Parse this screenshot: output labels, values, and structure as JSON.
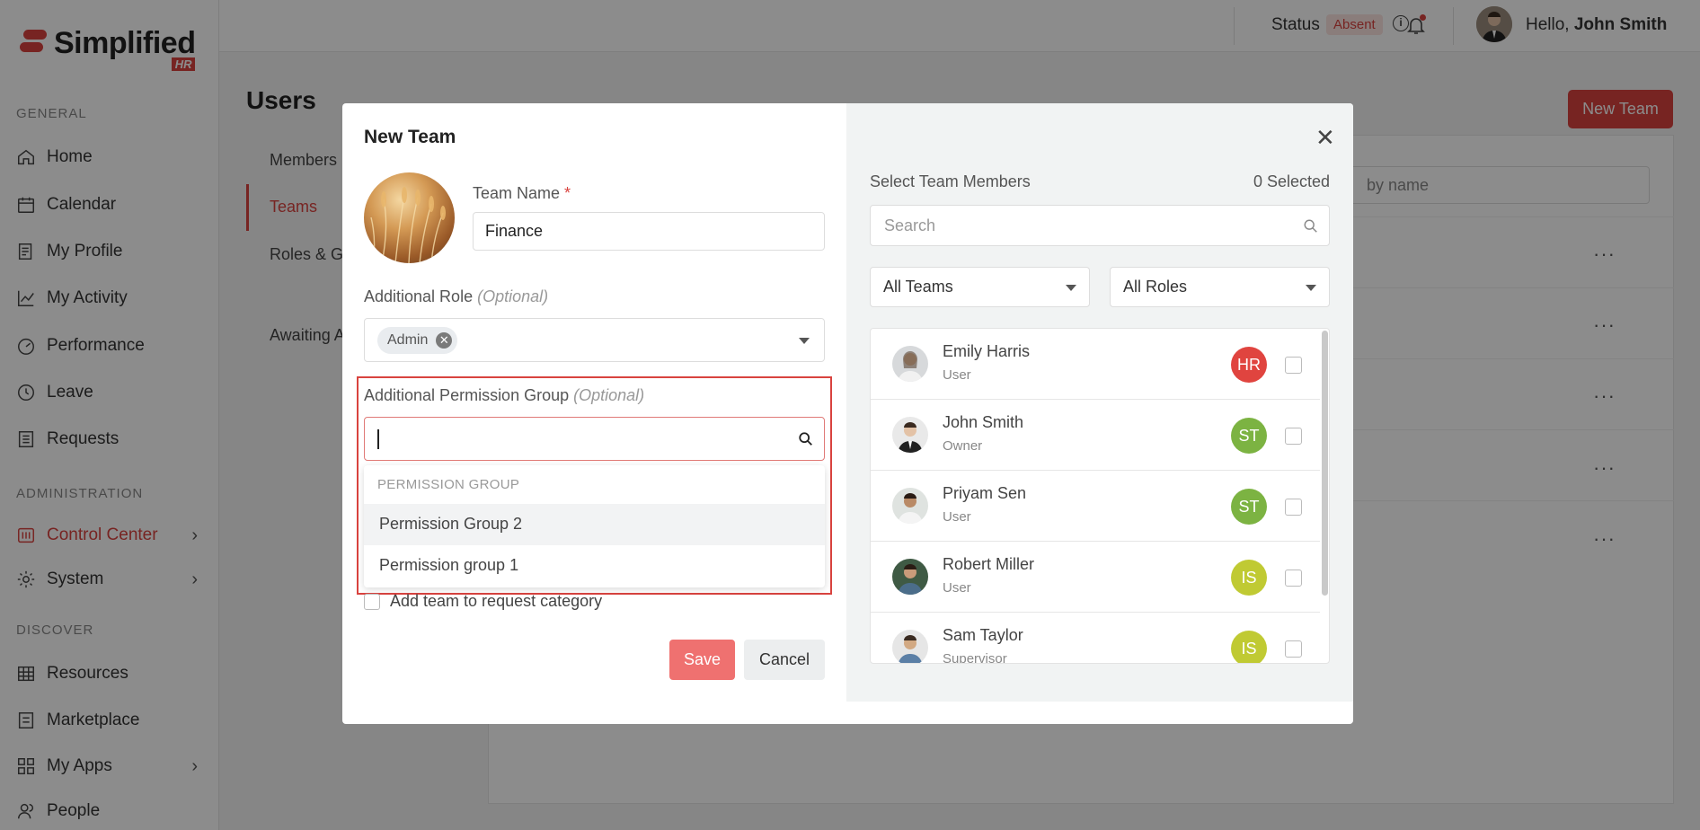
{
  "brand": {
    "name": "Simplified",
    "tag": "HR",
    "accent": "#d9433f"
  },
  "sidebar": {
    "sections": [
      "GENERAL",
      "ADMINISTRATION",
      "DISCOVER"
    ],
    "items": [
      {
        "label": "Home",
        "icon": "home-icon"
      },
      {
        "label": "Calendar",
        "icon": "calendar-icon"
      },
      {
        "label": "My Profile",
        "icon": "profile-icon"
      },
      {
        "label": "My Activity",
        "icon": "activity-icon"
      },
      {
        "label": "Performance",
        "icon": "performance-icon"
      },
      {
        "label": "Leave",
        "icon": "clock-icon"
      },
      {
        "label": "Requests",
        "icon": "requests-icon"
      },
      {
        "label": "Control Center",
        "icon": "control-center-icon",
        "active": true
      },
      {
        "label": "System",
        "icon": "gear-icon"
      },
      {
        "label": "Resources",
        "icon": "resources-icon"
      },
      {
        "label": "Marketplace",
        "icon": "marketplace-icon"
      },
      {
        "label": "My Apps",
        "icon": "apps-icon"
      },
      {
        "label": "People",
        "icon": "people-icon"
      }
    ]
  },
  "topbar": {
    "status_label": "Status",
    "status_value": "Absent",
    "hello": "Hello,",
    "user_name": "John Smith"
  },
  "page": {
    "title": "Users",
    "new_team_button": "New Team",
    "subnav": [
      "Members",
      "Teams",
      "Roles & Gr",
      "Awaiting A"
    ],
    "search_placeholder": "by name"
  },
  "modal": {
    "title": "New Team",
    "team_name_label": "Team Name",
    "required_mark": "*",
    "team_name_value": "Finance",
    "role_label": "Additional Role",
    "optional_text": "(Optional)",
    "role_chip": "Admin",
    "perm_label": "Additional Permission Group",
    "perm_input_value": "",
    "dropdown": {
      "group_header": "PERMISSION GROUP",
      "options": [
        "Permission Group 2",
        "Permission group 1"
      ]
    },
    "request_category_label": "Add team to request category",
    "save_button": "Save",
    "cancel_button": "Cancel",
    "select_members_title": "Select Team Members",
    "selected_count": "0 Selected",
    "member_search_placeholder": "Search",
    "filter_teams": "All Teams",
    "filter_roles": "All Roles",
    "members": [
      {
        "name": "Emily Harris",
        "role": "User",
        "badge": "HR",
        "badge_color": "#e0443f"
      },
      {
        "name": "John Smith",
        "role": "Owner",
        "badge": "ST",
        "badge_color": "#7cb342"
      },
      {
        "name": "Priyam Sen",
        "role": "User",
        "badge": "ST",
        "badge_color": "#7cb342"
      },
      {
        "name": "Robert Miller",
        "role": "User",
        "badge": "IS",
        "badge_color": "#c0ca33"
      },
      {
        "name": "Sam Taylor",
        "role": "Supervisor",
        "badge": "IS",
        "badge_color": "#c0ca33"
      }
    ]
  }
}
